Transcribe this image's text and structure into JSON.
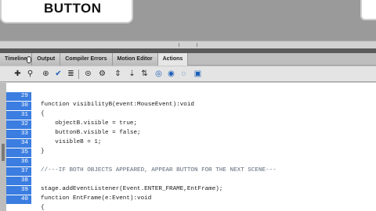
{
  "stage": {
    "button_label": "BUTTON"
  },
  "tabs": [
    {
      "label": "Timeline"
    },
    {
      "label": "Output"
    },
    {
      "label": "Compiler Errors"
    },
    {
      "label": "Motion Editor"
    },
    {
      "label": "Actions"
    }
  ],
  "toolbar": {
    "icons": [
      "add-script-icon",
      "find-icon",
      "target-icon",
      "check-syntax-icon",
      "auto-format-icon",
      "code-hint-icon",
      "debug-options-icon",
      "collapse-icon",
      "collapse-selection-icon",
      "expand-all-icon",
      "block-comment-icon",
      "line-comment-icon",
      "remove-comment-icon",
      "toolbox-icon"
    ]
  },
  "code_lines": [
    {
      "num": "29",
      "text": "function visibilityB(event:MouseEvent):void"
    },
    {
      "num": "30",
      "text": "{"
    },
    {
      "num": "31",
      "text": "    objectB.visible = true;"
    },
    {
      "num": "32",
      "text": "    buttonB.visible = false;"
    },
    {
      "num": "33",
      "text": "    visibleB = 1;"
    },
    {
      "num": "34",
      "text": "}"
    },
    {
      "num": "35",
      "text": ""
    },
    {
      "num": "36",
      "text": "//---IF BOTH OBJECTS APPEARED, APPEAR BUTTON FOR THE NEXT SCENE---"
    },
    {
      "num": "37",
      "text": ""
    },
    {
      "num": "38",
      "text": "stage.addEventListener(Event.ENTER_FRAME,EntFrame);"
    },
    {
      "num": "39",
      "text": "function EntFrame(e:Event):void"
    },
    {
      "num": "40",
      "text": "{"
    }
  ]
}
